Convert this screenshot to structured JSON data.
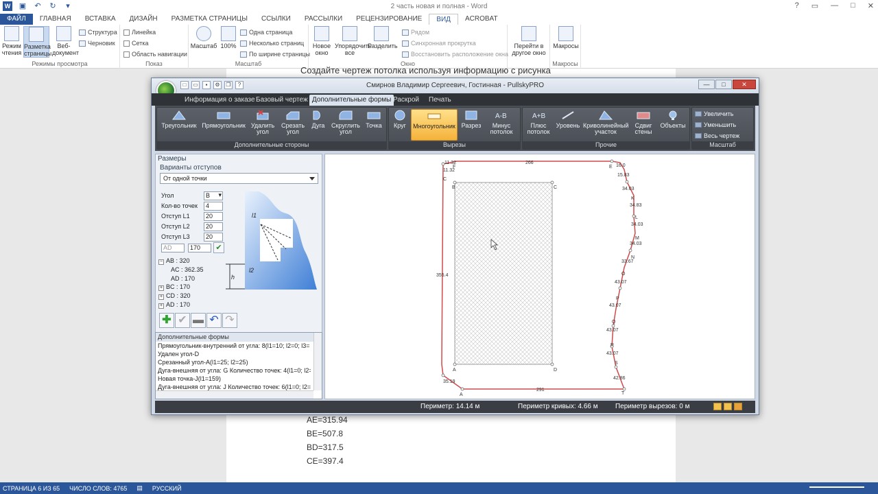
{
  "word": {
    "title": "2 часть новая и полная - Word",
    "tabs": [
      "ФАЙЛ",
      "ГЛАВНАЯ",
      "ВСТАВКА",
      "ДИЗАЙН",
      "РАЗМЕТКА СТРАНИЦЫ",
      "ССЫЛКИ",
      "РАССЫЛКИ",
      "РЕЦЕНЗИРОВАНИЕ",
      "ВИД",
      "ACROBAT"
    ],
    "active_tab": "ВИД",
    "ribbon": {
      "views": {
        "label": "Режимы просмотра",
        "read": "Режим чтения",
        "layout": "Разметка страницы",
        "web": "Веб-документ",
        "structure": "Структура",
        "draft": "Черновик"
      },
      "show": {
        "label": "Показ",
        "ruler": "Линейка",
        "grid": "Сетка",
        "nav": "Область навигации"
      },
      "zoom": {
        "label": "Масштаб",
        "zoom": "Масштаб",
        "p100": "100%",
        "one_page": "Одна страница",
        "multi_page": "Несколько страниц",
        "page_width": "По ширине страницы"
      },
      "window": {
        "label": "Окно",
        "new": "Новое окно",
        "arrange": "Упорядочить все",
        "split": "Разделить",
        "side": "Рядом",
        "sync": "Синхронная прокрутка",
        "reset": "Восстановить расположение окна",
        "switch": "Перейти в другое окно"
      },
      "macros": {
        "label": "Макросы",
        "macros": "Макросы"
      }
    },
    "doc": {
      "heading": "Создайте чертеж потолка используя информацию с рисунка",
      "lines": [
        "AE=315.94",
        "BE=507.8",
        "BD=317.5",
        "CE=397.4"
      ]
    },
    "status": {
      "page": "СТРАНИЦА 6 ИЗ 65",
      "words": "ЧИСЛО СЛОВ: 4765",
      "lang": "РУССКИЙ"
    }
  },
  "app": {
    "title": "Смирнов Владимир Сергеевич, Гостинная - PullskyPRO",
    "tabs": [
      "Информация о заказе",
      "Базовый чертеж",
      "Дополнительные формы",
      "Раскрой",
      "Печать"
    ],
    "active_tab": "Дополнительные формы",
    "ribbon": {
      "groups": [
        {
          "label": "Дополнительные стороны",
          "buttons": [
            "Треугольник",
            "Прямоугольник",
            "Удалить угол",
            "Срезать угол",
            "Дуга",
            "Скруглить угол",
            "Точка"
          ]
        },
        {
          "label": "Вырезы",
          "buttons": [
            "Круг",
            "Многоугольник",
            "Разрез",
            "Минус потолок"
          ]
        },
        {
          "label": "Прочие",
          "buttons": [
            "Плюс потолок",
            "Уровень",
            "Криволинейный участок",
            "Сдвиг стены",
            "Объекты"
          ]
        },
        {
          "label": "Масштаб",
          "buttons": [
            "Увеличить",
            "Уменьшить",
            "Весь чертеж"
          ]
        }
      ],
      "selected": "Многоугольник"
    },
    "left": {
      "sizes_title": "Размеры",
      "offsets_title": "Варианты отступов",
      "offset_option": "От одной точки",
      "fields": [
        {
          "label": "Угол",
          "value": "B"
        },
        {
          "label": "Кол-во точек",
          "value": "4"
        },
        {
          "label": "Отступ L1",
          "value": "20"
        },
        {
          "label": "Отступ L2",
          "value": "20"
        },
        {
          "label": "Отступ L3",
          "value": "20"
        }
      ],
      "side_name": "AD",
      "side_value": "170",
      "diagram_labels": {
        "l1": "l1",
        "l2": "l2",
        "h": "h"
      },
      "tree": [
        {
          "text": "AB : 320",
          "level": 0,
          "sign": "−"
        },
        {
          "text": "AC : 362.35",
          "level": 1,
          "sign": ""
        },
        {
          "text": "AD : 170",
          "level": 1,
          "sign": ""
        },
        {
          "text": "BC : 170",
          "level": 0,
          "sign": "+"
        },
        {
          "text": "CD : 320",
          "level": 0,
          "sign": "+"
        },
        {
          "text": "AD : 170",
          "level": 0,
          "sign": "+"
        }
      ],
      "list_title": "Дополнительные формы",
      "list": [
        "Прямоугольник-внутренний от угла: 8(l1=10; l2=0; l3=",
        "Удален угол-D",
        "Срезанный угол-A(l1=25; l2=25)",
        "Дуга-внешняя от угла: G Количество точек: 4(l1=0; l2=",
        "Новая точка-J(l1=159)",
        "Дуга-внешняя от угла: J Количество точек: 6(l1=0; l2="
      ]
    },
    "drawing": {
      "top_dim": "266",
      "bottom_dim": "291",
      "left_dim": "355.4",
      "corner_tl_a": "11.32",
      "corner_tl_b": "11.32",
      "corner_bl": "35.19",
      "top_right": "16.0",
      "right_dims": [
        "15.83",
        "34.03",
        "34.83",
        "34.03",
        "34.03",
        "33.67",
        "43.07",
        "43.07",
        "43.07",
        "43.07",
        "42.86"
      ],
      "right_points": [
        "K",
        "L",
        "M",
        "N",
        "O",
        "P",
        "Q",
        "R",
        "S",
        "T"
      ],
      "rect_labels": {
        "tl": "B",
        "tr": "C",
        "bl": "A",
        "br": "D"
      },
      "outer_labels": {
        "c": "C",
        "a": "A",
        "f": "F",
        "e": "E"
      }
    },
    "status": {
      "perimeter": "Периметр: 14.14 м",
      "curves": "Периметр кривых: 4.66 м",
      "cuts": "Периметр вырезов: 0 м"
    }
  }
}
